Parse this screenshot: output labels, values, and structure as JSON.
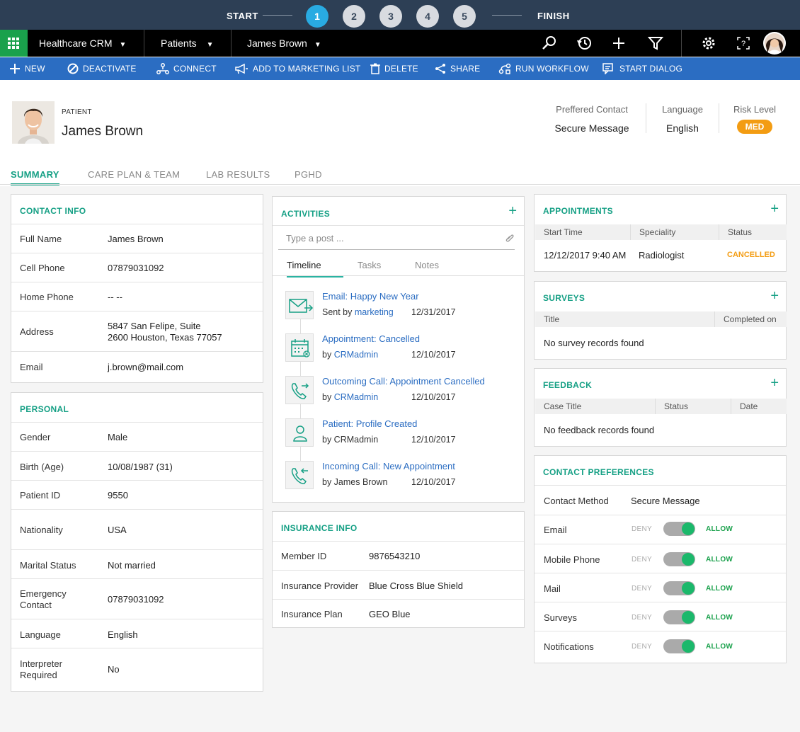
{
  "progress": {
    "start": "START",
    "finish": "FINISH",
    "steps": [
      "1",
      "2",
      "3",
      "4",
      "5"
    ],
    "active_step": 1
  },
  "topnav": {
    "app": "Healthcare CRM",
    "entity": "Patients",
    "record": "James Brown",
    "icons": [
      "search-icon",
      "history-icon",
      "plus-icon",
      "filter-icon",
      "gear-icon",
      "help-icon",
      "user-avatar"
    ]
  },
  "cmdbar": {
    "new": "NEW",
    "deactivate": "DEACTIVATE",
    "connect": "CONNECT",
    "add_marketing": "ADD TO MARKETING LIST",
    "delete": "DELETE",
    "share": "SHARE",
    "run_workflow": "RUN WORKFLOW",
    "start_dialog": "START DIALOG"
  },
  "header": {
    "type_label": "PATIENT",
    "name": "James Brown",
    "preferred_contact_label": "Preffered Contact",
    "preferred_contact_value": "Secure Message",
    "language_label": "Language",
    "language_value": "English",
    "risk_label": "Risk Level",
    "risk_value": "MED"
  },
  "tabs": {
    "summary": "SUMMARY",
    "care": "CARE PLAN & TEAM",
    "lab": "LAB RESULTS",
    "pghd": "PGHD"
  },
  "contact_info": {
    "title": "CONTACT INFO",
    "full_name_label": "Full Name",
    "full_name": "James Brown",
    "cell_label": "Cell Phone",
    "cell": "07879031092",
    "home_label": "Home Phone",
    "home": "-- --",
    "address_label": "Address",
    "address_line1": "5847 San Felipe, Suite",
    "address_line2": "2600  Houston, Texas 77057",
    "email_label": "Email",
    "email": "j.brown@mail.com"
  },
  "personal": {
    "title": "PERSONAL",
    "gender_label": "Gender",
    "gender": "Male",
    "birth_label": "Birth (Age)",
    "birth": "10/08/1987 (31)",
    "pid_label": "Patient ID",
    "pid": "9550",
    "nationality_label": "Nationality",
    "nationality": "USA",
    "marital_label": "Marital Status",
    "marital": "Not married",
    "emergency_label_1": "Emergency",
    "emergency_label_2": "Contact",
    "emergency": "07879031092",
    "language_label": "Language",
    "language": "English",
    "interpreter_label_1": "Interpreter",
    "interpreter_label_2": "Required",
    "interpreter": "No"
  },
  "activities": {
    "title": "ACTIVITIES",
    "post_placeholder": "Type a post ...",
    "tab_timeline": "Timeline",
    "tab_tasks": "Tasks",
    "tab_notes": "Notes",
    "items": [
      {
        "title": "Email: Happy New Year",
        "by": "Sent by",
        "who": "marketing",
        "date": "12/31/2017"
      },
      {
        "title": "Appointment: Cancelled",
        "by": "by",
        "who": "CRMadmin",
        "date": "12/10/2017"
      },
      {
        "title": "Outcoming Call: Appointment Cancelled",
        "by": "by",
        "who": "CRMadmin",
        "date": "12/10/2017"
      },
      {
        "title": "Patient: Profile Created",
        "by": "by CRMadmin",
        "who": "",
        "date": "12/10/2017"
      },
      {
        "title": "Incoming Call: New Appointment",
        "by": "by James Brown",
        "who": "",
        "date": "12/10/2017"
      }
    ]
  },
  "insurance": {
    "title": "INSURANCE INFO",
    "member_label": "Member ID",
    "member": "9876543210",
    "provider_label": "Insurance Provider",
    "provider": "Blue Cross Blue Shield",
    "plan_label": "Insurance Plan",
    "plan": "GEO Blue"
  },
  "appointments": {
    "title": "APPOINTMENTS",
    "col_start": "Start Time",
    "col_spec": "Speciality",
    "col_status": "Status",
    "row_start": "12/12/2017  9:40 AM",
    "row_spec": "Radiologist",
    "row_status": "CANCELLED"
  },
  "surveys": {
    "title": "SURVEYS",
    "col_title": "Title",
    "col_completed": "Completed on",
    "empty": "No survey records found"
  },
  "feedback": {
    "title": "FEEDBACK",
    "col_case": "Case Title",
    "col_status": "Status",
    "col_date": "Date",
    "empty": "No feedback records found"
  },
  "prefs": {
    "title": "CONTACT PREFERENCES",
    "method_label": "Contact Method",
    "method": "Secure Message",
    "deny": "DENY",
    "allow": "ALLOW",
    "items": [
      "Email",
      "Mobile Phone",
      "Mail",
      "Surveys",
      "Notifications"
    ]
  },
  "colors": {
    "accent": "#16a085",
    "brand_blue": "#2b6dc2",
    "nav_dark": "#2d3f55",
    "risk": "#f39c12",
    "cancelled": "#f39c12"
  }
}
